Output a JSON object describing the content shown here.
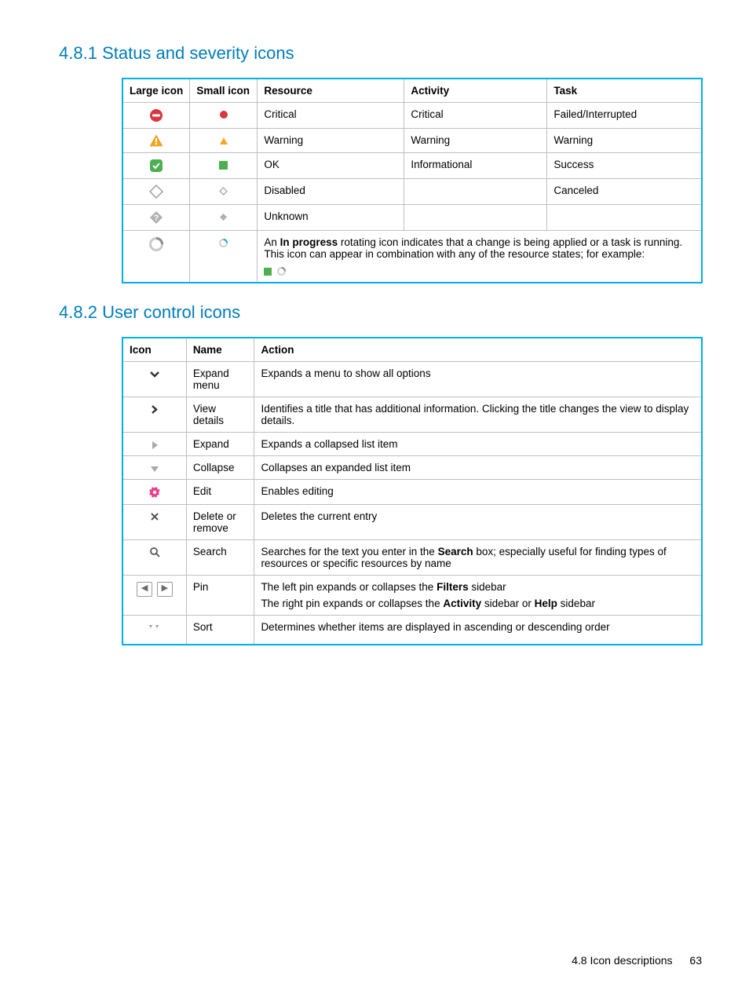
{
  "section1": {
    "number": "4.8.1",
    "title": "Status and severity icons",
    "headers": [
      "Large icon",
      "Small icon",
      "Resource",
      "Activity",
      "Task"
    ],
    "rows": [
      {
        "large": "critical-large",
        "small": "critical-small",
        "resource": "Critical",
        "activity": "Critical",
        "task": "Failed/Interrupted"
      },
      {
        "large": "warning-large",
        "small": "warning-small",
        "resource": "Warning",
        "activity": "Warning",
        "task": "Warning"
      },
      {
        "large": "ok-large",
        "small": "ok-small",
        "resource": "OK",
        "activity": "Informational",
        "task": "Success"
      },
      {
        "large": "disabled-large",
        "small": "disabled-small",
        "resource": "Disabled",
        "activity": "",
        "task": "Canceled"
      },
      {
        "large": "unknown-large",
        "small": "unknown-small",
        "resource": "Unknown",
        "activity": "",
        "task": ""
      }
    ],
    "progress": {
      "large": "progress-large",
      "small": "progress-small",
      "text_pre": "An ",
      "text_bold": "In progress",
      "text_post": " rotating icon indicates that a change is being applied or a task is running. This icon can appear in combination with any of the resource states; for example:"
    }
  },
  "section2": {
    "number": "4.8.2",
    "title": "User control icons",
    "headers": [
      "Icon",
      "Name",
      "Action"
    ],
    "rows": [
      {
        "icon": "expand-menu",
        "name": "Expand menu",
        "action": "Expands a menu to show all options"
      },
      {
        "icon": "view-details",
        "name": "View details",
        "action": "Identifies a title that has additional information. Clicking the title changes the view to display details."
      },
      {
        "icon": "expand",
        "name": "Expand",
        "action": "Expands a collapsed list item"
      },
      {
        "icon": "collapse",
        "name": "Collapse",
        "action": "Collapses an expanded list item"
      },
      {
        "icon": "edit",
        "name": "Edit",
        "action": "Enables editing"
      },
      {
        "icon": "delete",
        "name": "Delete or remove",
        "action": "Deletes the current entry"
      },
      {
        "icon": "search",
        "name": "Search",
        "action_html": "Searches for the text you enter in the <b>Search</b> box; especially useful for finding types of resources or specific resources by name"
      },
      {
        "icon": "pin",
        "name": "Pin",
        "action_html": "The left pin expands or collapses the <b>Filters</b> sidebar<br><span style='display:block;height:6px'></span>The right pin expands or collapses the <b>Activity</b> sidebar or <b>Help</b> sidebar"
      },
      {
        "icon": "sort",
        "name": "Sort",
        "action": "Determines whether items are displayed in ascending or descending order"
      }
    ]
  },
  "footer": {
    "section": "4.8 Icon descriptions",
    "page": "63"
  }
}
